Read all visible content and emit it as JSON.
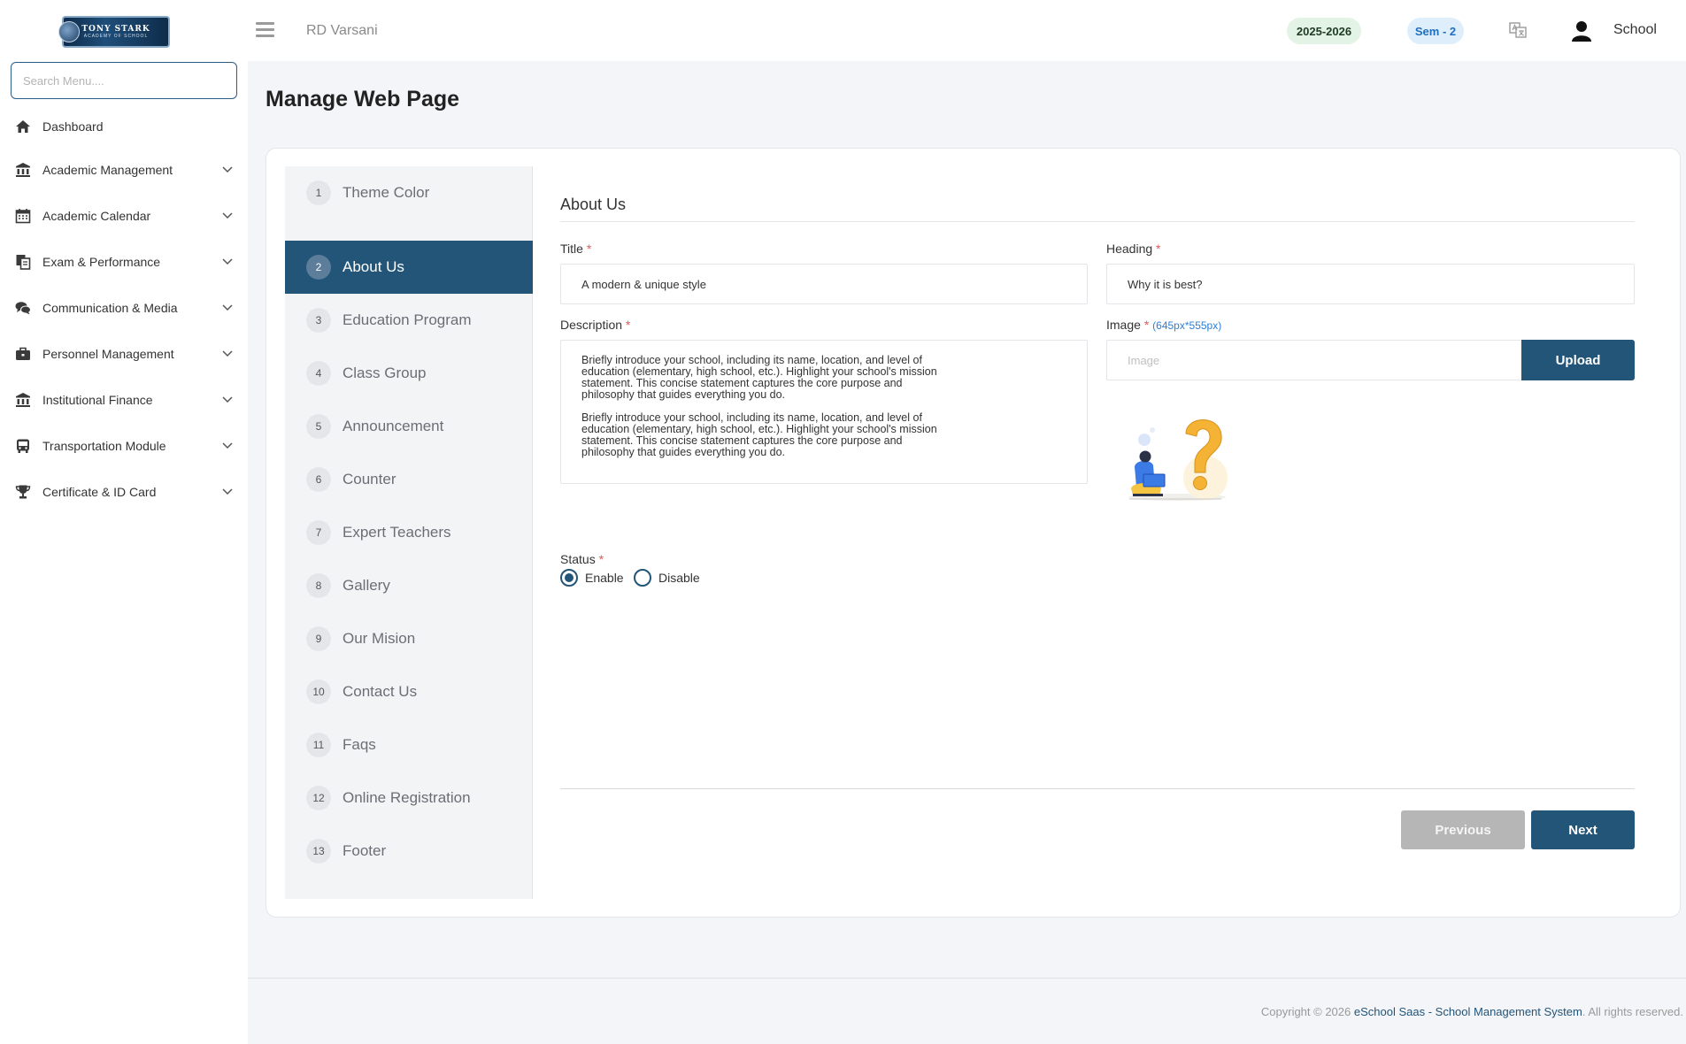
{
  "header": {
    "logo_text": "TONY STARK",
    "logo_subtext": "ACADEMY OF SCHOOL",
    "school_name": "RD Varsani",
    "session_year": "2025-2026",
    "semester": "Sem - 2",
    "user_label": "School"
  },
  "sidebar": {
    "search_placeholder": "Search Menu....",
    "items": [
      {
        "label": "Dashboard",
        "icon": "home-icon"
      },
      {
        "label": "Academic Management",
        "icon": "bank-icon"
      },
      {
        "label": "Academic Calendar",
        "icon": "calendar-icon"
      },
      {
        "label": "Exam & Performance",
        "icon": "files-icon"
      },
      {
        "label": "Communication & Media",
        "icon": "comments-icon"
      },
      {
        "label": "Personnel Management",
        "icon": "briefcase-icon"
      },
      {
        "label": "Institutional Finance",
        "icon": "bank-icon"
      },
      {
        "label": "Transportation Module",
        "icon": "bus-icon"
      },
      {
        "label": "Certificate & ID Card",
        "icon": "trophy-icon"
      }
    ]
  },
  "page": {
    "title": "Manage Web Page"
  },
  "steps": [
    {
      "num": "1",
      "label": "Theme Color"
    },
    {
      "num": "2",
      "label": "About Us",
      "active": true
    },
    {
      "num": "3",
      "label": "Education Program"
    },
    {
      "num": "4",
      "label": "Class Group"
    },
    {
      "num": "5",
      "label": "Announcement"
    },
    {
      "num": "6",
      "label": "Counter"
    },
    {
      "num": "7",
      "label": "Expert Teachers"
    },
    {
      "num": "8",
      "label": "Gallery"
    },
    {
      "num": "9",
      "label": "Our Mision"
    },
    {
      "num": "10",
      "label": "Contact Us"
    },
    {
      "num": "11",
      "label": "Faqs"
    },
    {
      "num": "12",
      "label": "Online Registration"
    },
    {
      "num": "13",
      "label": "Footer"
    }
  ],
  "form": {
    "section_title": "About Us",
    "title_label": "Title",
    "title_value": "A modern & unique style",
    "heading_label": "Heading",
    "heading_value": "Why it is best?",
    "description_label": "Description",
    "description_paragraphs": [
      "Briefly introduce your school, including its name, location, and level of education (elementary, high school, etc.). Highlight your school's mission statement. This concise statement captures the core purpose and philosophy that guides everything you do.",
      "Briefly introduce your school, including its name, location, and level of education (elementary, high school, etc.). Highlight your school's mission statement. This concise statement captures the core purpose and philosophy that guides everything you do."
    ],
    "image_label": "Image",
    "image_hint": "(645px*555px)",
    "image_placeholder": "Image",
    "upload_label": "Upload",
    "status_label": "Status",
    "status_options": [
      "Enable",
      "Disable"
    ],
    "status_selected": "Enable",
    "required_mark": "*",
    "previous_label": "Previous",
    "next_label": "Next"
  },
  "footer": {
    "prefix": "Copyright © 2026 ",
    "link": "eSchool Saas - School Management System",
    "suffix": ". All rights reserved."
  },
  "colors": {
    "primary": "#235578",
    "year_pill_bg": "#e3f3e5",
    "sem_pill_bg": "#dfeefb",
    "required": "#e05a5a",
    "previous_bg": "#b7b6b6"
  }
}
